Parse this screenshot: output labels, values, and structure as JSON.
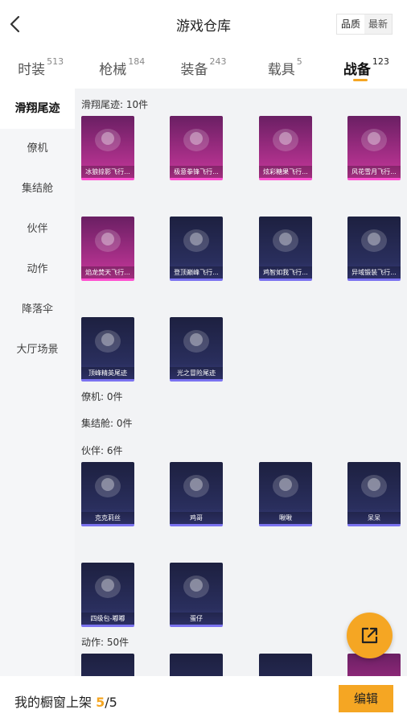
{
  "header": {
    "title": "游戏仓库",
    "sort_options": [
      "品质",
      "最新"
    ]
  },
  "tabs": [
    {
      "label": "时装",
      "count": "513"
    },
    {
      "label": "枪械",
      "count": "184"
    },
    {
      "label": "装备",
      "count": "243"
    },
    {
      "label": "载具",
      "count": "5"
    },
    {
      "label": "战备",
      "count": "123"
    }
  ],
  "sidebar": {
    "items": [
      "滑翔尾迹",
      "僚机",
      "集结舱",
      "伙伴",
      "动作",
      "降落伞",
      "大厅场景"
    ]
  },
  "sections": {
    "glide": {
      "title": "滑翔尾迹: 10件",
      "items": [
        {
          "name": "冰狼掠影飞行...",
          "rarity": "pink"
        },
        {
          "name": "极意拳锋飞行...",
          "rarity": "pink"
        },
        {
          "name": "炫彩糖果飞行...",
          "rarity": "pink"
        },
        {
          "name": "风花雪月飞行...",
          "rarity": "pink"
        },
        {
          "name": "焰龙焚天飞行...",
          "rarity": "pink"
        },
        {
          "name": "登顶巅峰飞行...",
          "rarity": "blue"
        },
        {
          "name": "鸡智如我飞行...",
          "rarity": "blue"
        },
        {
          "name": "异域锻装飞行...",
          "rarity": "blue"
        },
        {
          "name": "顶峰精英尾迹",
          "rarity": "blue"
        },
        {
          "name": "光之冒险尾迹",
          "rarity": "blue"
        }
      ]
    },
    "wingman": {
      "title": "僚机: 0件"
    },
    "capsule": {
      "title": "集结舱: 0件"
    },
    "partner": {
      "title": "伙伴: 6件",
      "items": [
        {
          "name": "克克莉丝",
          "rarity": "blue"
        },
        {
          "name": "鸡哥",
          "rarity": "blue"
        },
        {
          "name": "啾啾",
          "rarity": "blue"
        },
        {
          "name": "呆呆",
          "rarity": "blue"
        },
        {
          "name": "四级包-嘟嘟",
          "rarity": "blue"
        },
        {
          "name": "蛋仔",
          "rarity": "blue"
        }
      ]
    },
    "action": {
      "title": "动作: 50件"
    }
  },
  "bottom": {
    "label": "我的橱窗上架",
    "shown": "5",
    "total": "/5",
    "edit_label": "编辑"
  },
  "colors": {
    "accent": "#f5a623",
    "pink_rarity": "#ff4fd0",
    "blue_rarity": "#7b72f0"
  }
}
